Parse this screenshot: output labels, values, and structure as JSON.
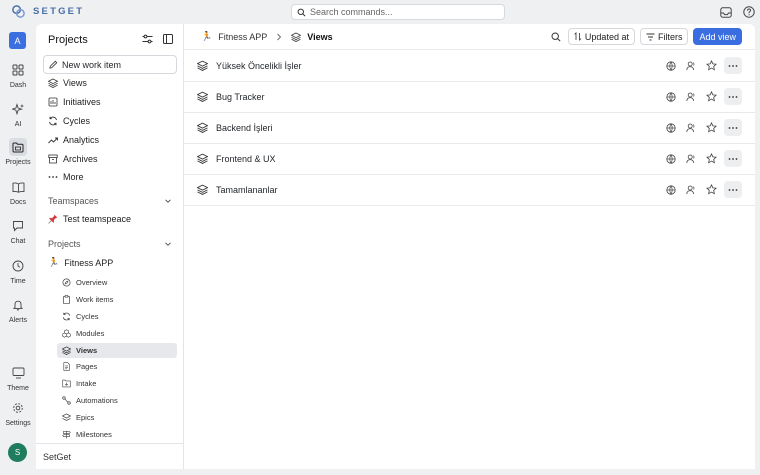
{
  "app": {
    "name": "SETGET"
  },
  "search": {
    "placeholder": "Search commands..."
  },
  "rail": {
    "avatar": "A",
    "items": [
      {
        "label": "Dash"
      },
      {
        "label": "AI"
      },
      {
        "label": "Projects"
      },
      {
        "label": "Docs"
      },
      {
        "label": "Chat"
      },
      {
        "label": "Time"
      },
      {
        "label": "Alerts"
      },
      {
        "label": "Theme"
      },
      {
        "label": "Settings"
      }
    ],
    "user_initial": "S"
  },
  "sidebar": {
    "title": "Projects",
    "new_item": "New work item",
    "nav": [
      {
        "label": "Views"
      },
      {
        "label": "Initiatives"
      },
      {
        "label": "Cycles"
      },
      {
        "label": "Analytics"
      },
      {
        "label": "Archives"
      },
      {
        "label": "More"
      }
    ],
    "teamspaces_label": "Teamspaces",
    "teamspace_item": "Test teamspeace",
    "projects_label": "Projects",
    "project_name": "Fitness APP",
    "project_subitems": [
      {
        "label": "Overview"
      },
      {
        "label": "Work items"
      },
      {
        "label": "Cycles"
      },
      {
        "label": "Modules"
      },
      {
        "label": "Views"
      },
      {
        "label": "Pages"
      },
      {
        "label": "Intake"
      },
      {
        "label": "Automations"
      },
      {
        "label": "Epics"
      },
      {
        "label": "Milestones"
      }
    ],
    "footer": "SetGet"
  },
  "header": {
    "breadcrumb_project": "Fitness APP",
    "breadcrumb_current": "Views",
    "updated_label": "Updated at",
    "filters_label": "Filters",
    "add_view_label": "Add view"
  },
  "views": [
    {
      "name": "Yüksek Öncelikli İşler"
    },
    {
      "name": "Bug Tracker"
    },
    {
      "name": "Backend İşleri"
    },
    {
      "name": "Frontend & UX"
    },
    {
      "name": "Tamamlananlar"
    }
  ],
  "colors": {
    "accent": "#3a6ee0",
    "logo": "#4a6fa8",
    "user_avatar": "#1e7d5d"
  }
}
